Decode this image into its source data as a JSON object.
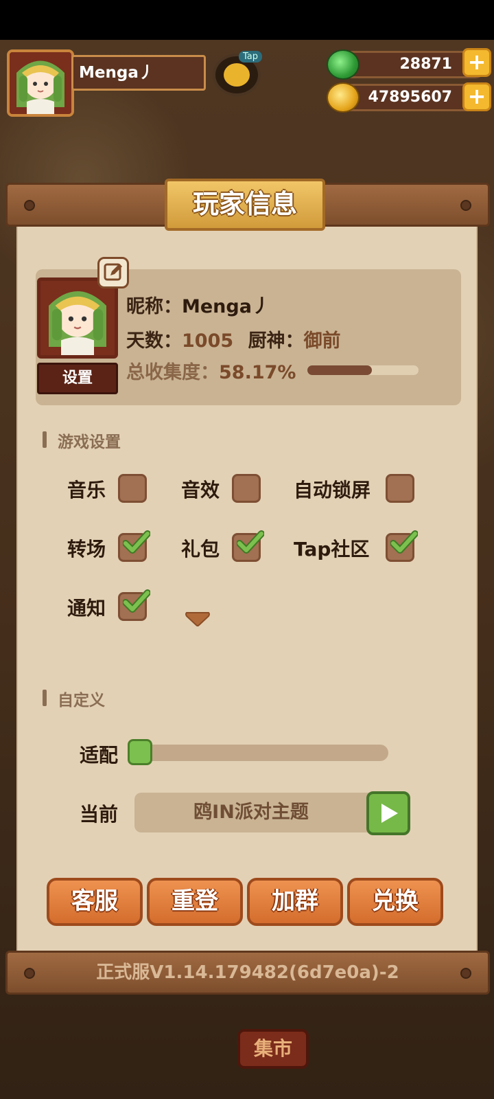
{
  "player": {
    "name": "Menga丿"
  },
  "currency": {
    "jade": "28871",
    "coins": "47895607"
  },
  "top": {
    "tap_tag": "Tap"
  },
  "panel": {
    "title": "玩家信息",
    "profile": {
      "nickname_label": "昵称：",
      "nickname": "Menga丿",
      "days_label": "天数：",
      "days": "1005",
      "chef_label": "厨神：",
      "chef": "御前",
      "collection_label": "总收集度：",
      "collection": "58.17%",
      "collection_fraction": 0.5817,
      "set_avatar_label": "设置"
    },
    "game_settings": {
      "title": "游戏设置",
      "options": [
        {
          "label": "音乐",
          "checked": false
        },
        {
          "label": "音效",
          "checked": false
        },
        {
          "label": "自动锁屏",
          "checked": false
        },
        {
          "label": "转场",
          "checked": true
        },
        {
          "label": "礼包",
          "checked": true
        },
        {
          "label": "Tap社区",
          "checked": true
        },
        {
          "label": "通知",
          "checked": true
        }
      ]
    },
    "custom": {
      "title": "自定义",
      "adapt_label": "适配",
      "adapt_value": 0,
      "current_label": "当前",
      "current_theme": "鸥IN派对主题"
    },
    "actions": {
      "service": "客服",
      "relogin": "重登",
      "join_group": "加群",
      "redeem": "兑换"
    },
    "version": "正式服V1.14.179482(6d7e0a)-2"
  },
  "background": {
    "market_label": "集市"
  },
  "colors": {
    "check_green": "#7cc04f",
    "button_orange": "#e4803d",
    "panel_bg": "#e3d1b5",
    "title_gold": "#e2b150"
  }
}
